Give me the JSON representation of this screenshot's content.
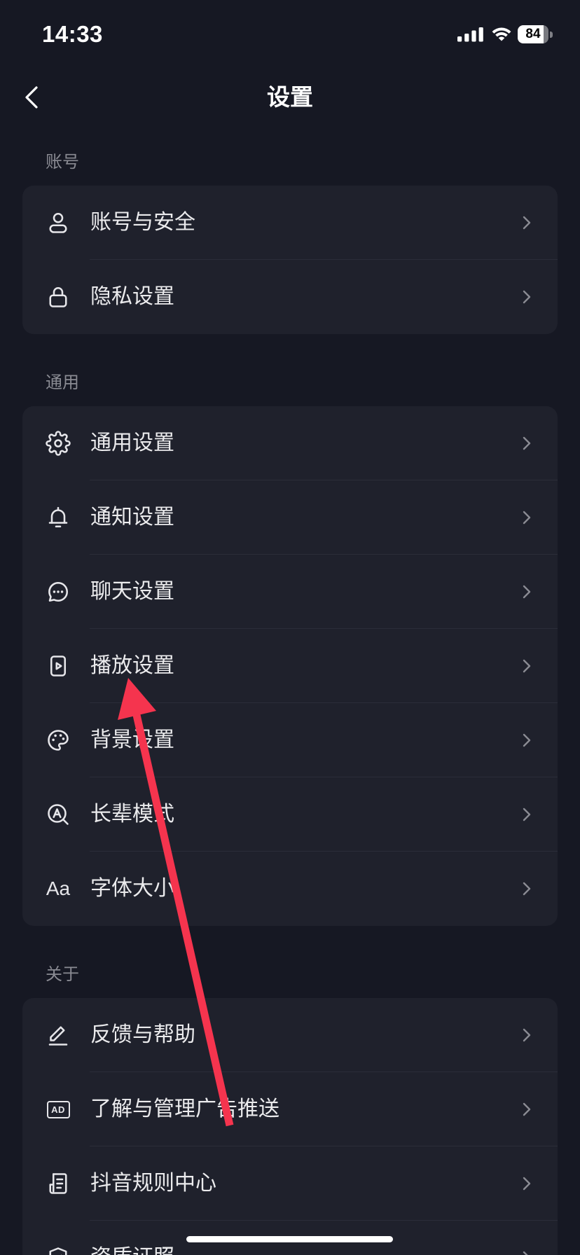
{
  "status_bar": {
    "time": "14:33",
    "battery": "84",
    "signal_icon": "cellular-signal-icon",
    "wifi_icon": "wifi-icon",
    "battery_icon": "battery-icon"
  },
  "nav": {
    "title": "设置",
    "back_icon": "chevron-left-icon"
  },
  "sections": [
    {
      "header": "账号",
      "items": [
        {
          "label": "账号与安全",
          "icon": "person-icon"
        },
        {
          "label": "隐私设置",
          "icon": "lock-icon"
        }
      ]
    },
    {
      "header": "通用",
      "items": [
        {
          "label": "通用设置",
          "icon": "gear-icon"
        },
        {
          "label": "通知设置",
          "icon": "bell-icon"
        },
        {
          "label": "聊天设置",
          "icon": "chat-bubble-icon"
        },
        {
          "label": "播放设置",
          "icon": "play-icon"
        },
        {
          "label": "背景设置",
          "icon": "palette-icon"
        },
        {
          "label": "长辈模式",
          "icon": "elder-mode-icon"
        },
        {
          "label": "字体大小",
          "icon": "font-size-icon",
          "icon_text": "Aa"
        }
      ]
    },
    {
      "header": "关于",
      "items": [
        {
          "label": "反馈与帮助",
          "icon": "pencil-icon"
        },
        {
          "label": "了解与管理广告推送",
          "icon": "ad-icon",
          "icon_text": "AD"
        },
        {
          "label": "抖音规则中心",
          "icon": "rules-document-icon"
        },
        {
          "label": "资质证照",
          "icon": "shield-icon"
        }
      ]
    }
  ],
  "theme": {
    "background": "#161823",
    "card": "#1f212c",
    "text": "#ebebed",
    "secondary_text": "#8a8b93",
    "divider": "#2b2d39",
    "chevron": "#8a8b93",
    "icon": "#e6e6ea",
    "annotation_arrow": "#f5344e"
  }
}
